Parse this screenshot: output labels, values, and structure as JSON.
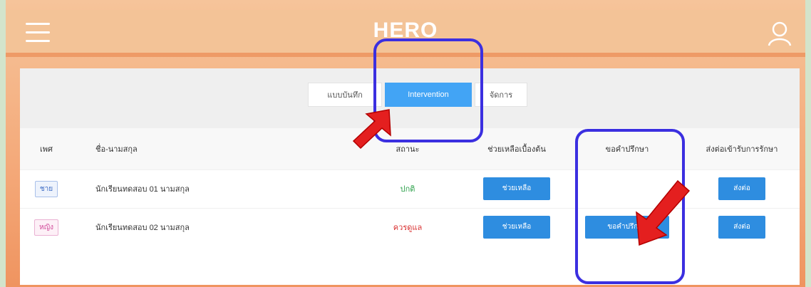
{
  "app": {
    "title": "HERO",
    "menu_icon": "hamburger-menu-icon",
    "user_icon": "user-icon"
  },
  "tabs": [
    {
      "label": "แบบบันทึก",
      "active": false
    },
    {
      "label": "Intervention",
      "active": true
    },
    {
      "label": "จัดการ",
      "active": false
    }
  ],
  "table": {
    "headers": {
      "sex": "เพศ",
      "name": "ชื่อ-นามสกุล",
      "status": "สถานะ",
      "help": "ช่วยเหลือเบื้องต้น",
      "consult": "ขอคำปรึกษา",
      "refer": "ส่งต่อเข้ารับการรักษา"
    },
    "rows": [
      {
        "sex": "ชาย",
        "name": "นักเรียนทดสอบ 01 นามสกุล",
        "status": "ปกติ",
        "help_button": "ช่วยเหลือ",
        "consult_button": "",
        "refer_button": "ส่งต่อ"
      },
      {
        "sex": "หญิง",
        "name": "นักเรียนทดสอบ 02 นามสกุล",
        "status": "ควรดูแล",
        "help_button": "ช่วยเหลือ",
        "consult_button": "ขอคำปรึกษา",
        "refer_button": "ส่งต่อ"
      }
    ]
  },
  "colors": {
    "header_bg": "#f3c397",
    "accent": "#2e8de0",
    "active_tab": "#42a4f5",
    "annotation_box": "#3b2fe0",
    "annotation_arrow": "#e41f1f",
    "status_normal": "#2da14b",
    "status_watch": "#d93030"
  }
}
